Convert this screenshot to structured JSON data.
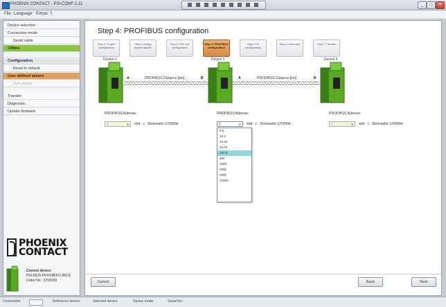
{
  "window": {
    "title": "PHOENIX CONTACT - PSI-CONF 2.11",
    "minimize": "_",
    "maximize": "□",
    "close": "×"
  },
  "menu": [
    "File",
    "Language",
    "Extras",
    "?"
  ],
  "sidebar": {
    "items": [
      {
        "label": "Device selection",
        "style": "normal"
      },
      {
        "label": "Connection mode",
        "style": "normal"
      },
      {
        "label": "Serial cable",
        "style": "sub"
      },
      {
        "label": "Offline",
        "style": "green"
      },
      {
        "label": "Configuration",
        "style": "header"
      },
      {
        "label": "Reset to default",
        "style": "sub"
      },
      {
        "label": "User defined wizard",
        "style": "orange"
      },
      {
        "label": "Sub wizard",
        "style": "disabled"
      },
      {
        "label": "Transfer",
        "style": "normal"
      },
      {
        "label": "Diagnostic",
        "style": "normal"
      },
      {
        "label": "Update firmware",
        "style": "normal"
      }
    ],
    "logo_top": "PHOENIX",
    "logo_bottom": "CONTACT",
    "device_info": {
      "heading": "Current device:",
      "line1": "PSI-MOS-PROFIB/FO 850 E",
      "line2": "Order No.: 2708290"
    }
  },
  "main": {
    "title": "Step 4: PROFIBUS configuration",
    "tabs": [
      {
        "label": "Step 1 Project configuration",
        "active": false
      },
      {
        "label": "Step 2 Assign device names",
        "active": false
      },
      {
        "label": "Step 3 OZL line configuration",
        "active": false
      },
      {
        "label": "Step 4: PROFIBUS configuration",
        "active": true
      },
      {
        "label": "Step 5 IO configuration",
        "active": false
      },
      {
        "label": "Step 6 Summary",
        "active": false
      },
      {
        "label": "Step 7 Transfer",
        "active": false
      }
    ],
    "devices": [
      {
        "name": "Device 1",
        "profibus_label": "PROFIBUS Adresse:",
        "address": "1",
        "unit": "kbit",
        "sep": "=",
        "result": "Slotmaster 12000bit"
      },
      {
        "name": "Device 2",
        "profibus_label": "PROFIBUS Adresse:",
        "address": "1",
        "unit": "kbit",
        "sep": "=",
        "result": "Slotmaster 12000bit"
      },
      {
        "name": "Device 3",
        "profibus_label": "PROFIBUS Adresse:",
        "address": "1",
        "unit": "kbit",
        "sep": "=",
        "result": "Slotmaster 12000bit"
      }
    ],
    "cables": [
      {
        "a": "A",
        "label": "PROFIBUS Distance [km]",
        "b": "B"
      },
      {
        "a": "A",
        "label": "PROFIBUS Distance [km]",
        "b": "B"
      }
    ],
    "dropdown_options": [
      "9.6",
      "19.2",
      "45.45",
      "93.75",
      "187.5",
      "500",
      "1500",
      "3000",
      "6000",
      "12000"
    ],
    "dropdown_selected": "187.5",
    "buttons": {
      "cancel": "Cancel",
      "back": "Back",
      "next": "Next"
    }
  },
  "statusbar": {
    "items": [
      "Connection:",
      "Reference device:",
      "Selected device:",
      "Device mode:",
      "Serial No.:"
    ]
  },
  "colors": {
    "accent_green": "#8cc63f",
    "accent_orange": "#e0a25c",
    "device_green": "#6cbf2a",
    "highlight": "#8fd7e3"
  }
}
